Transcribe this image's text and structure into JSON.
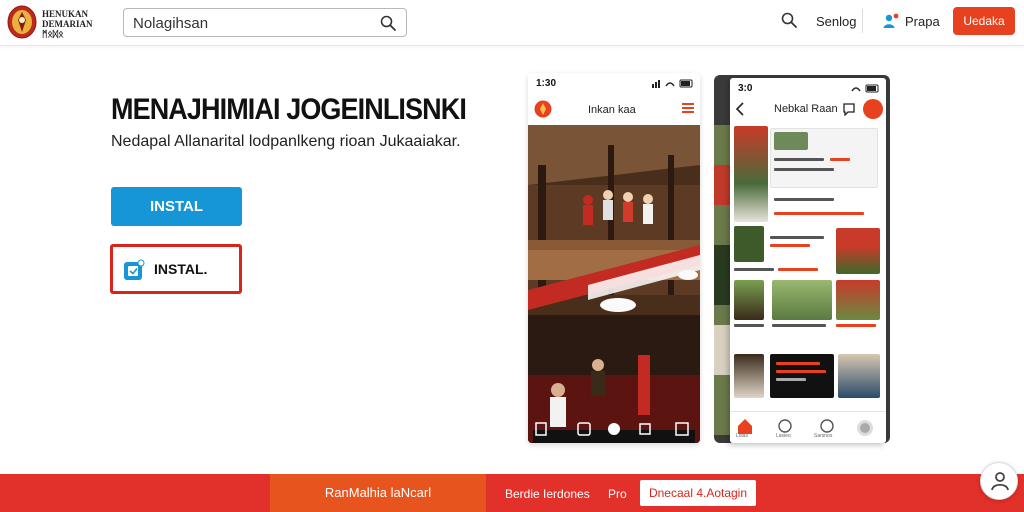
{
  "header": {
    "logo_lines": [
      "HENUKAN",
      "DEMARIAN",
      "ᛗᛟᛞᛟ"
    ],
    "search": {
      "value": "Nolagihsan"
    },
    "links": {
      "search_label": "Senlog",
      "user_label": "Prapa"
    },
    "button_label": "Uedaka"
  },
  "hero": {
    "title": "MENAJHIMIAI JOGEINLISNKI",
    "subtitle": "Nedapal Allanarital lodpanlkeng rioan Jukaaiakar.",
    "install_primary": "INSTAL",
    "install_secondary": "INSTAL."
  },
  "phone1": {
    "time": "1:30",
    "title": "Inkan kaa"
  },
  "phone2": {
    "time": "3:0",
    "title": "Nebkal Raan",
    "nav_labels": [
      "Lolas",
      "Lasieo",
      "Sarsnos",
      ""
    ]
  },
  "footer": {
    "primary_label": "RanMalhia laNcarl",
    "link1": "Berdie Ierdones",
    "link2": "Pro",
    "outline_label": "Dnecaal 4.Aotagin"
  },
  "colors": {
    "accent_red": "#e2302b",
    "accent_orange": "#e8541d",
    "install_blue": "#1696d6"
  }
}
